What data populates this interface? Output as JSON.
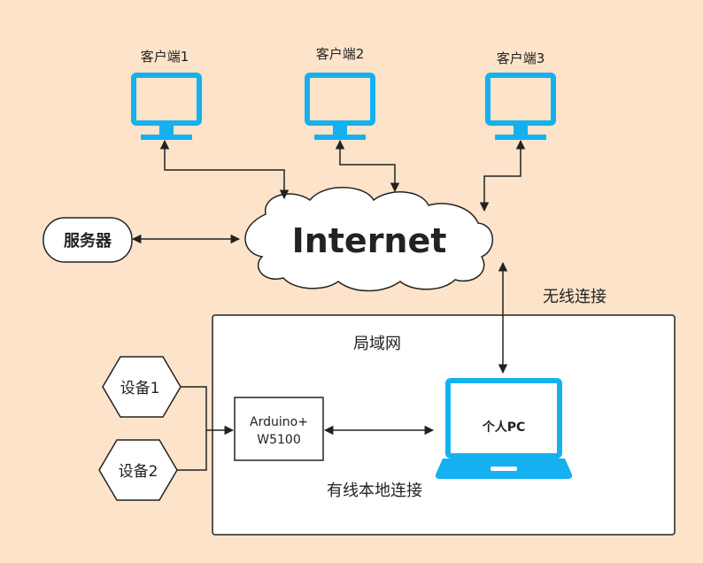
{
  "clients": [
    {
      "label": "客户端1"
    },
    {
      "label": "客户端2"
    },
    {
      "label": "客户端3"
    }
  ],
  "server": {
    "label": "服务器"
  },
  "internet": {
    "label": "Internet"
  },
  "wireless": {
    "label": "无线连接"
  },
  "lan": {
    "label": "局域网"
  },
  "devices": [
    {
      "label": "设备1"
    },
    {
      "label": "设备2"
    }
  ],
  "arduino": {
    "line1": "Arduino+",
    "line2": "W5100"
  },
  "pc": {
    "label": "个人PC"
  },
  "wired": {
    "label": "有线本地连接"
  },
  "colors": {
    "background": "#fde3c9",
    "monitor": "#15b0ef",
    "stroke": "#222222",
    "box_fill": "#ffffff"
  },
  "icons": [
    "monitor-icon",
    "cloud-icon",
    "laptop-icon",
    "hexagon-shape"
  ]
}
